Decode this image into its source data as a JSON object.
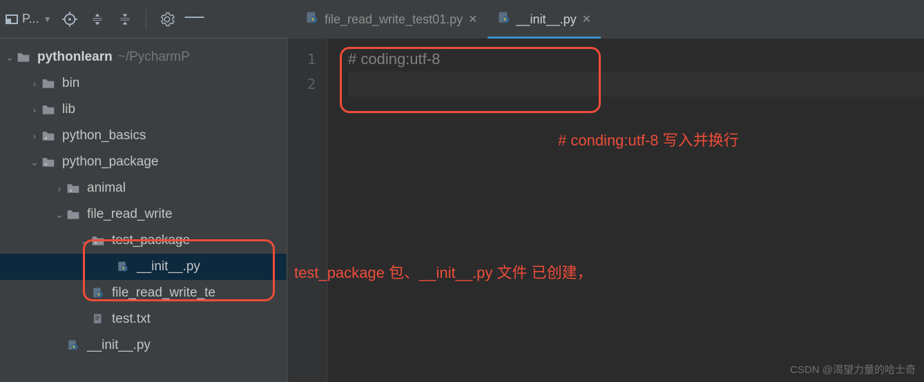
{
  "toolbar": {
    "project_label": "P..."
  },
  "tabs": [
    {
      "label": "file_read_write_test01.py",
      "active": false
    },
    {
      "label": "__init__.py",
      "active": true
    }
  ],
  "tree": {
    "root": {
      "label": "pythonlearn",
      "path": "~/PycharmP"
    },
    "bin": "bin",
    "lib": "lib",
    "python_basics": "python_basics",
    "python_package": "python_package",
    "animal": "animal",
    "file_read_write": "file_read_write",
    "test_package": "test_package",
    "init_py": "__init__.py",
    "file_rw_test": "file_read_write_te",
    "test_txt": "test.txt",
    "pkg_init": "__init__.py"
  },
  "code": {
    "line1": "# coding:utf-8",
    "line2": ""
  },
  "gutter": [
    "1",
    "2"
  ],
  "annotations": {
    "text1": "# conding:utf-8 写入并换行",
    "text2": "test_package 包、__init__.py 文件 已创建，"
  },
  "watermark": "CSDN @渴望力量的哈士奇"
}
